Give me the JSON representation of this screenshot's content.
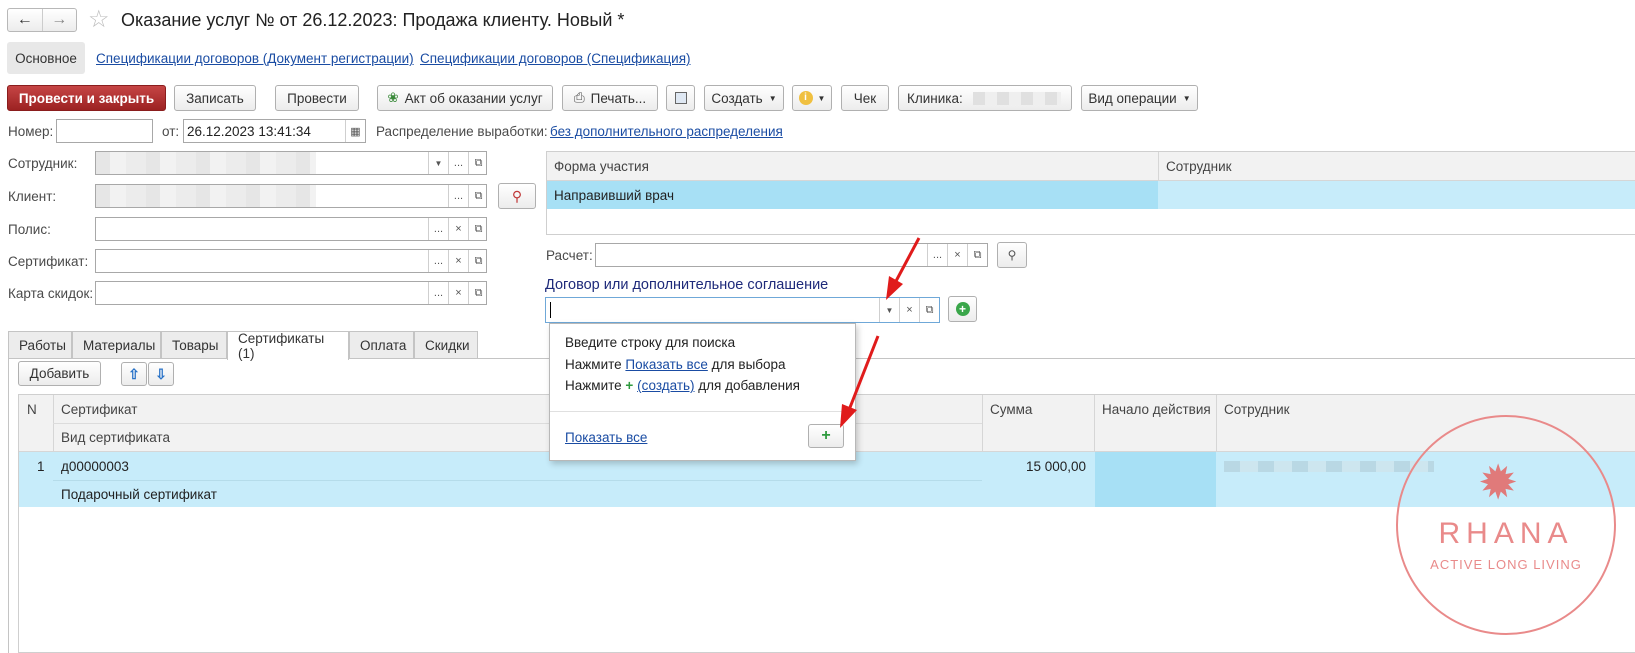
{
  "window": {
    "title": "Оказание услуг №  от 26.12.2023: Продажа клиенту.  Новый *"
  },
  "topnav": {
    "tabs": [
      {
        "label": "Основное"
      },
      {
        "label": "Спецификации договоров (Документ регистрации)"
      },
      {
        "label": "Спецификации договоров (Спецификация)"
      }
    ]
  },
  "toolbar": {
    "post_close": "Провести и закрыть",
    "save": "Записать",
    "post": "Провести",
    "act": "Акт об оказании услуг",
    "print": "Печать...",
    "create": "Создать",
    "check": "Чек",
    "clinic_label": "Клиника:",
    "operation_type": "Вид операции"
  },
  "header_fields": {
    "number_label": "Номер:",
    "number_value": "",
    "date_label": "от:",
    "date_value": "26.12.2023 13:41:34",
    "distribution_label": "Распределение выработки:",
    "distribution_value": "без дополнительного распределения"
  },
  "left_fields": {
    "employee_label": "Сотрудник:",
    "client_label": "Клиент:",
    "policy_label": "Полис:",
    "certificate_label": "Сертификат:",
    "discount_label": "Карта скидок:"
  },
  "participation": {
    "headers": [
      "Форма участия",
      "Сотрудник"
    ],
    "rows": [
      {
        "form": "Направивший врач",
        "employee": ""
      }
    ]
  },
  "calc": {
    "label": "Расчет:"
  },
  "contract": {
    "title": "Договор или дополнительное соглашение",
    "input_value": ""
  },
  "dropdown": {
    "line1": "Введите строку для поиска",
    "line2_prefix": "Нажмите",
    "line2_link": "Показать все",
    "line2_suffix": "для выбора",
    "line3_prefix": "Нажмите",
    "line3_link": "(создать)",
    "line3_suffix": "для добавления",
    "show_all": "Показать все"
  },
  "tabs": [
    {
      "label": "Работы"
    },
    {
      "label": "Материалы"
    },
    {
      "label": "Товары"
    },
    {
      "label": "Сертификаты (1)"
    },
    {
      "label": "Оплата"
    },
    {
      "label": "Скидки"
    }
  ],
  "cert_toolbar": {
    "add": "Добавить"
  },
  "cert_table": {
    "headers": {
      "n": "N",
      "certificate": "Сертификат",
      "certificate_type": "Вид сертификата",
      "sum": "Сумма",
      "start": "Начало действия",
      "employee": "Сотрудник"
    },
    "rows": [
      {
        "n": "1",
        "certificate": "д00000003",
        "type": "Подарочный сертификат",
        "sum": "15 000,00",
        "start": ""
      }
    ]
  },
  "watermark": {
    "brand": "RHANA",
    "tagline": "ACTIVE LONG LIVING"
  },
  "colors": {
    "accent_red": "#a82828",
    "selection_blue": "#c7ecfa",
    "selection_dark": "#a7e0f5",
    "link": "#1a4ca3",
    "arrow": "#e01b1b",
    "watermark": "#e98a8a"
  }
}
